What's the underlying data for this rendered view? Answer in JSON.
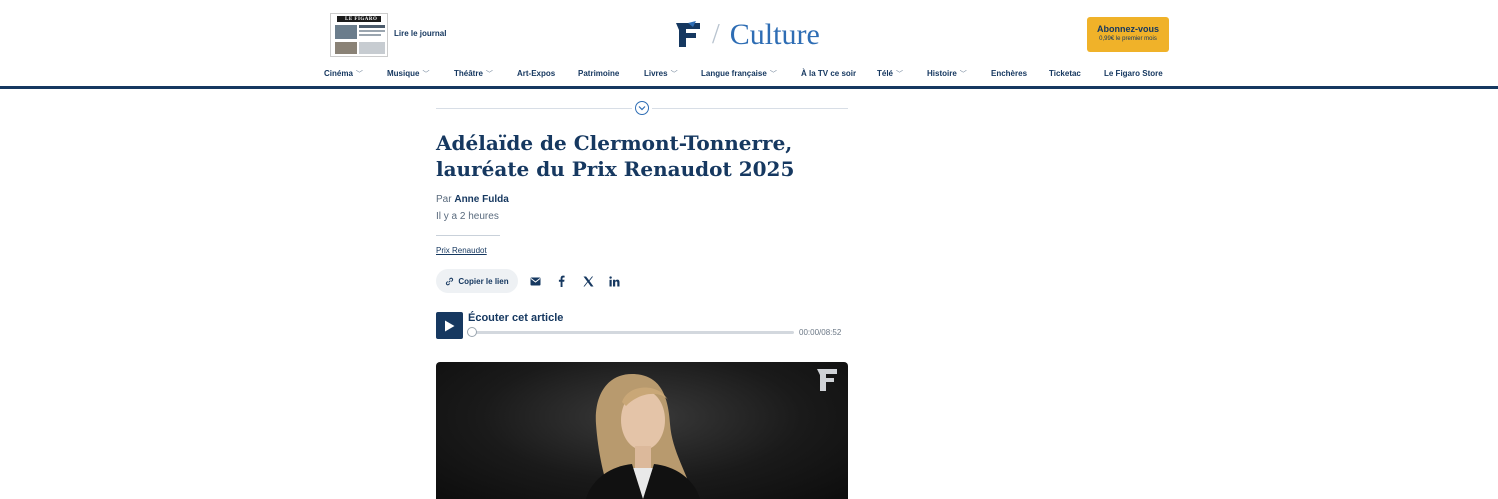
{
  "header": {
    "journal_link": "Lire le journal",
    "journal_masthead": "LE FIGARO",
    "section_title": "Culture",
    "subscribe": {
      "label": "Abonnez-vous",
      "sublabel": "0,99€ le premier mois"
    }
  },
  "nav": {
    "items": [
      {
        "label": "Cinéma",
        "dropdown": true
      },
      {
        "label": "Musique",
        "dropdown": true
      },
      {
        "label": "Théâtre",
        "dropdown": true
      },
      {
        "label": "Art-Expos",
        "dropdown": false
      },
      {
        "label": "Patrimoine",
        "dropdown": false
      },
      {
        "label": "Livres",
        "dropdown": true
      },
      {
        "label": "Langue française",
        "dropdown": true
      },
      {
        "label": "À la TV ce soir",
        "dropdown": false
      },
      {
        "label": "Télé",
        "dropdown": true
      },
      {
        "label": "Histoire",
        "dropdown": true
      },
      {
        "label": "Enchères",
        "dropdown": false
      },
      {
        "label": "Ticketac",
        "dropdown": false
      },
      {
        "label": "Le Figaro Store",
        "dropdown": false
      }
    ]
  },
  "article": {
    "title": "Adélaïde de Clermont-Tonnerre, lauréate du Prix Renaudot 2025",
    "byline_prefix": "Par",
    "author": "Anne Fulda",
    "published": "Il y a 2 heures",
    "tag": "Prix Renaudot",
    "copy_link_label": "Copier le lien"
  },
  "player": {
    "title": "Écouter cet article",
    "time": "00:00/08:52",
    "progress": 0
  },
  "colors": {
    "brand_navy": "#163860",
    "section_blue": "#2e6db4",
    "subscribe_yellow": "#f0b229"
  },
  "icons": {
    "nav_chevron": "chevron-down-icon",
    "copy": "link-icon",
    "share": [
      "email-icon",
      "facebook-icon",
      "x-icon",
      "linkedin-icon"
    ],
    "player": "play-icon"
  }
}
